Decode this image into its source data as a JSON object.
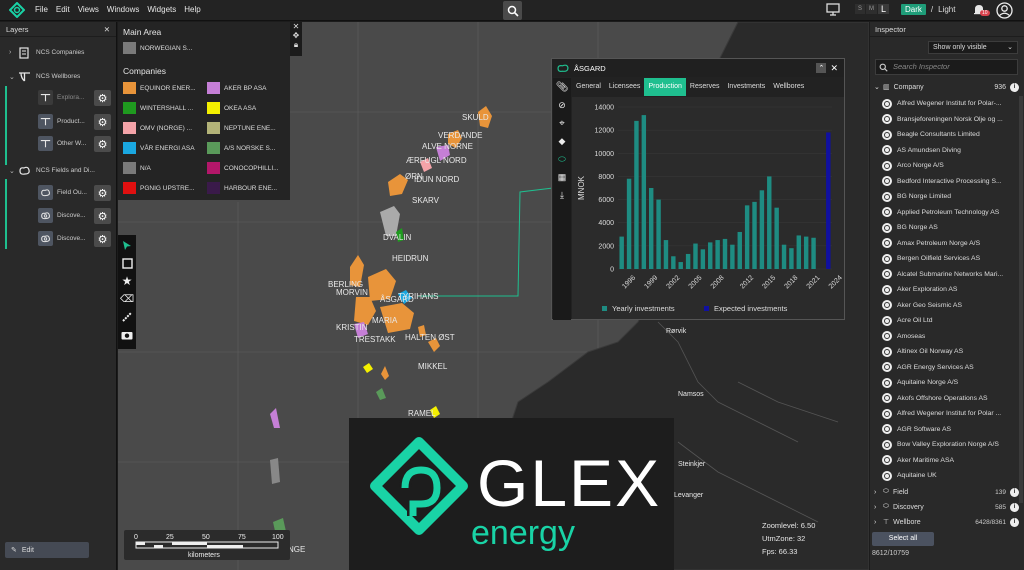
{
  "menu": [
    "File",
    "Edit",
    "Views",
    "Windows",
    "Widgets",
    "Help"
  ],
  "display_sizes": [
    "S",
    "M",
    "L"
  ],
  "theme": {
    "dark": "Dark",
    "separator": "/",
    "light": "Light"
  },
  "notifications": {
    "count": "10"
  },
  "layers": {
    "title": "Layers",
    "items": [
      {
        "label": "NCS Companies"
      },
      {
        "label": "NCS Wellbores"
      },
      {
        "label": "Explora..."
      },
      {
        "label": "Product..."
      },
      {
        "label": "Other W..."
      },
      {
        "label": "NCS Fields and Di..."
      },
      {
        "label": "Field Ou..."
      },
      {
        "label": "Discove..."
      },
      {
        "label": "Discove..."
      }
    ],
    "edit_label": "Edit"
  },
  "legend": {
    "main_area_title": "Main Area",
    "main_area_item": "NORWEGIAN S...",
    "companies_title": "Companies",
    "companies": [
      {
        "label": "EQUINOR ENER...",
        "color": "#e8943a"
      },
      {
        "label": "AKER BP ASA",
        "color": "#c57fd6"
      },
      {
        "label": "WINTERSHALL ...",
        "color": "#1f9a1f"
      },
      {
        "label": "OKEA ASA",
        "color": "#f4f000"
      },
      {
        "label": "OMV (NORGE) ...",
        "color": "#f4a3a8"
      },
      {
        "label": "NEPTUNE ENE...",
        "color": "#b3b378"
      },
      {
        "label": "VÅR ENERGI ASA",
        "color": "#1aa7e0"
      },
      {
        "label": "A/S NORSKE S...",
        "color": "#5a9a5a"
      },
      {
        "label": "N/A",
        "color": "#7a7a7a"
      },
      {
        "label": "CONOCOPHILLI...",
        "color": "#b3176a"
      },
      {
        "label": "PGNIG UPSTRE...",
        "color": "#e01010"
      },
      {
        "label": "HARBOUR ENE...",
        "color": "#3a1a4a"
      }
    ]
  },
  "map_labels": [
    "SKULD",
    "VERDANDE",
    "ALVE NORNE",
    "ÆRFUGL NORD",
    "ØRN",
    "IDUN NORD",
    "SKARV",
    "DVALIN",
    "HEIDRUN",
    "BERLING",
    "MORVIN",
    "ÅSGARD",
    "TYRIHANS",
    "MARIA",
    "KRISTIN",
    "TRESTAKK",
    "HALTEN ØST",
    "MIKKEL",
    "RAMEL",
    "NGE",
    "Rørvik",
    "Namsos",
    "Steinkjer",
    "Levanger"
  ],
  "scale": {
    "ticks": [
      "0",
      "25",
      "50",
      "75",
      "100"
    ],
    "unit": "kilometers"
  },
  "zoom": {
    "level": "Zoomlevel: 6.50",
    "utm": "UtmZone: 32",
    "fps": "Fps: 66.33"
  },
  "popup": {
    "title": "ÅSGARD",
    "tabs": [
      "General",
      "Licensees",
      "Production",
      "Reserves",
      "Investments",
      "Wellbores"
    ],
    "active_tab": "Production"
  },
  "chart_data": {
    "type": "bar",
    "ylabel": "MNOK",
    "ylim": [
      0,
      14000
    ],
    "yticks": [
      0,
      2000,
      4000,
      6000,
      8000,
      10000,
      12000,
      14000
    ],
    "xticks": [
      "1996",
      "1999",
      "2002",
      "2005",
      "2008",
      "2012",
      "2015",
      "2018",
      "2021",
      "2024"
    ],
    "categories": [
      "1996",
      "1997",
      "1998",
      "1999",
      "2000",
      "2001",
      "2002",
      "2003",
      "2004",
      "2005",
      "2006",
      "2007",
      "2008",
      "2009",
      "2010",
      "2011",
      "2012",
      "2013",
      "2014",
      "2015",
      "2016",
      "2017",
      "2018",
      "2019",
      "2020",
      "2021",
      "2022",
      "2023",
      "2024"
    ],
    "series": [
      {
        "name": "Yearly investments",
        "color": "#1e8c82",
        "values": [
          2800,
          7800,
          12800,
          13300,
          7000,
          6000,
          2500,
          1100,
          600,
          1300,
          2200,
          1700,
          2300,
          2500,
          2600,
          2100,
          3200,
          5500,
          5800,
          6800,
          8000,
          5300,
          2100,
          1800,
          2900,
          2800,
          2700,
          0,
          0
        ]
      },
      {
        "name": "Expected investments",
        "color": "#1010a0",
        "values": [
          0,
          0,
          0,
          0,
          0,
          0,
          0,
          0,
          0,
          0,
          0,
          0,
          0,
          0,
          0,
          0,
          0,
          0,
          0,
          0,
          0,
          0,
          0,
          0,
          0,
          0,
          0,
          0,
          11800
        ]
      }
    ]
  },
  "inspector": {
    "title": "Inspector",
    "filter": "Show only visible",
    "search_placeholder": "Search Inspector",
    "company_header": "Company",
    "company_count": "936",
    "companies": [
      "Alfred Wegener Institut for Polar-...",
      "Bransjeforeningen Norsk Olje og ...",
      "Beagle Consultants Limited",
      "AS Amundsen Diving",
      "Arco Norge A/S",
      "Bedford Interactive Processing S...",
      "BG Norge Limited",
      "Applied Petroleum Technology AS",
      "BG Norge AS",
      "Amax Petroleum Norge  A/S",
      "Bergen Oilfield Services AS",
      "Alcatel Submarine Networks Mari...",
      "Aker Exploration AS",
      "Aker Geo Seismic AS",
      "Acre Oil Ltd",
      "Amoseas",
      "Altinex Oil Norway AS",
      "AGR Energy Services AS",
      "Aquitaine Norge A/S",
      "Akofs Offshore Operations AS",
      "Alfred Wegener Institut for Polar ...",
      "AGR Software AS",
      "Bow Valley Exploration Norge A/S",
      "Aker Maritime ASA",
      "Aquitaine UK"
    ],
    "categories": [
      {
        "label": "Field",
        "count": "139"
      },
      {
        "label": "Discovery",
        "count": "585"
      },
      {
        "label": "Wellbore",
        "count": "6428/8361"
      }
    ],
    "select_all": "Select all",
    "selection_count": "8612/10759"
  },
  "brand": {
    "name": "GLEX",
    "sub": "energy",
    "accent": "#19d3a6"
  }
}
